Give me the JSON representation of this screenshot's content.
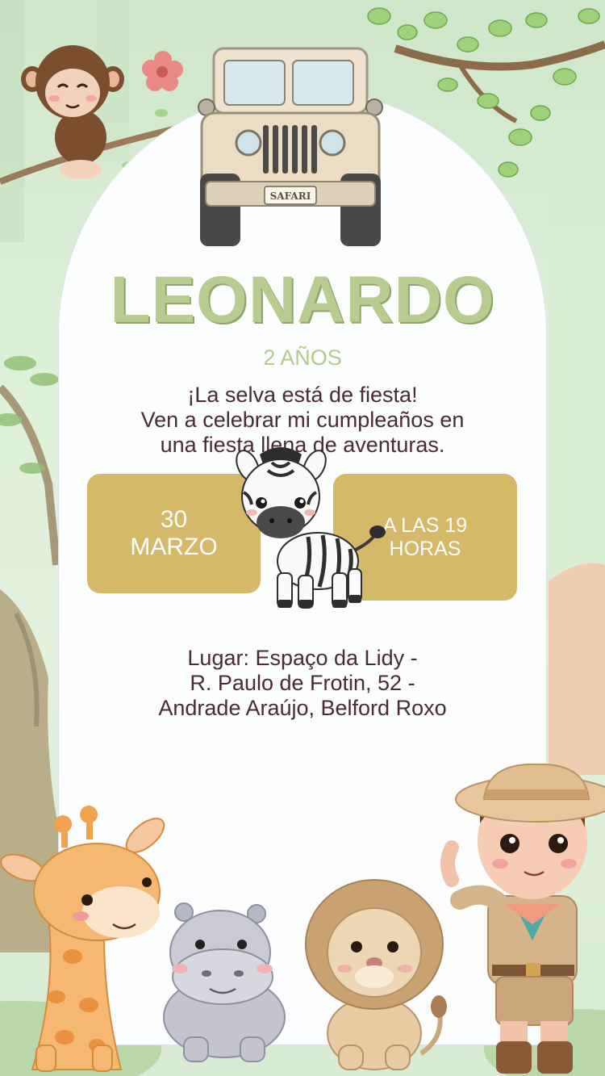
{
  "invitation": {
    "name": "LEONARDO",
    "age": "2 AÑOS",
    "message": [
      "¡La selva está de fiesta!",
      "Ven a celebrar mi cumpleaños en",
      "una fiesta llena de aventuras."
    ],
    "date": {
      "day": "30",
      "month": "MARZO"
    },
    "time": {
      "line1": "A LAS 19",
      "line2": "HORAS"
    },
    "place": [
      "Lugar: Espaço da Lidy -",
      "R. Paulo de Frotin, 52 -",
      "Andrade Araújo, Belford Roxo"
    ],
    "jeep_plate": "SAFARI"
  },
  "colors": {
    "background": "#cfe6cb",
    "card": "#fbfdff",
    "name": "#b9cc8f",
    "box": "#d6b968",
    "text": "#4a2c2f"
  },
  "icons": [
    "monkey-icon",
    "flower-icon",
    "jeep-icon",
    "tree-branch-icon",
    "zebra-icon",
    "giraffe-icon",
    "hippo-icon",
    "lion-icon",
    "explorer-boy-icon"
  ]
}
